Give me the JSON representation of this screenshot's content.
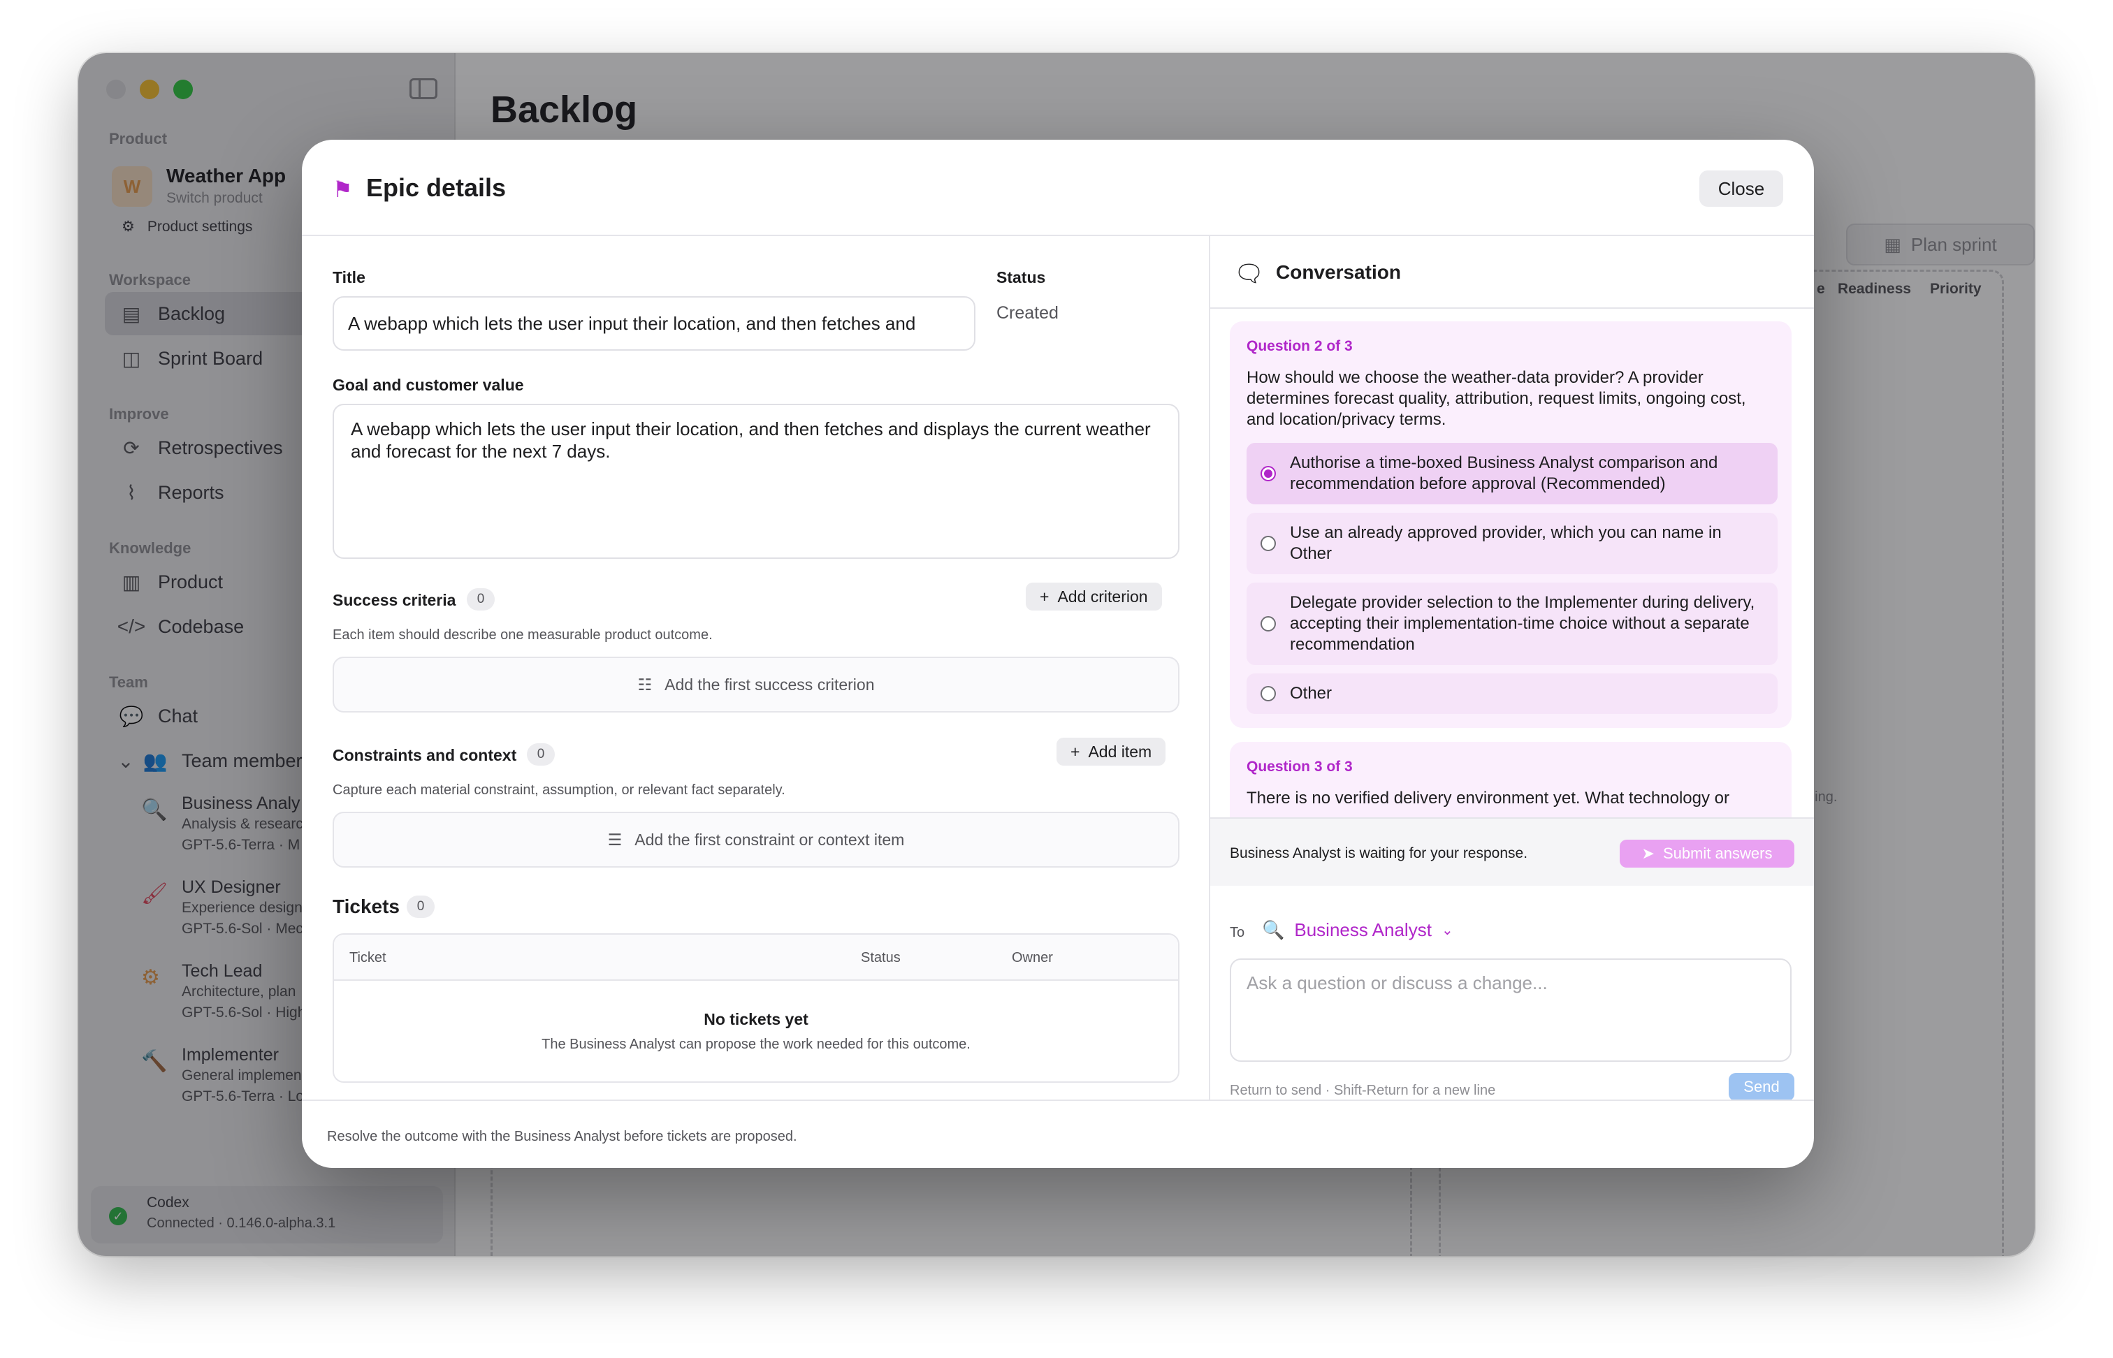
{
  "sidebar": {
    "product_section": "Product",
    "product_initial": "W",
    "product_name": "Weather App",
    "switch_product": "Switch product",
    "product_settings": "Product settings",
    "workspace_section": "Workspace",
    "backlog": "Backlog",
    "sprint_board": "Sprint Board",
    "improve_section": "Improve",
    "retrospectives": "Retrospectives",
    "reports": "Reports",
    "knowledge_section": "Knowledge",
    "product": "Product",
    "codebase": "Codebase",
    "team_section": "Team",
    "chat": "Chat",
    "team_members": "Team member",
    "agents": [
      {
        "name": "Business Analy",
        "line1": "Analysis & researc",
        "line2": "GPT-5.6-Terra · M",
        "icon": "magnifier-icon",
        "color": "#b027c9"
      },
      {
        "name": "UX Designer",
        "line1": "Experience design",
        "line2": "GPT-5.6-Sol · Mec",
        "icon": "brush-icon",
        "color": "#e0455a"
      },
      {
        "name": "Tech Lead",
        "line1": "Architecture, plan",
        "line2": "GPT-5.6-Sol · High",
        "icon": "nodes-icon",
        "color": "#e69a4a"
      },
      {
        "name": "Implementer",
        "line1": "General implemen",
        "line2": "GPT-5.6-Terra · Lo",
        "icon": "hammer-icon",
        "color": "#3a7bd5"
      }
    ],
    "codex_name": "Codex",
    "codex_status": "Connected · 0.146.0-alpha.3.1"
  },
  "main": {
    "title": "Backlog",
    "plan_sprint": "Plan sprint",
    "col_partial": "e",
    "col_readiness": "Readiness",
    "col_priority": "Priority",
    "empty_hint_partial": "ning."
  },
  "modal": {
    "title": "Epic details",
    "close": "Close",
    "title_label": "Title",
    "title_value": "A webapp which lets the user input their location, and then fetches and",
    "status_label": "Status",
    "status_value": "Created",
    "goal_label": "Goal and customer value",
    "goal_value": "A webapp which lets the user input their location, and then fetches and displays the current weather and forecast for the next 7 days.",
    "success_label": "Success criteria",
    "success_count": "0",
    "add_criterion": "Add criterion",
    "success_hint": "Each item should describe one measurable product outcome.",
    "success_empty": "Add the first success criterion",
    "constraints_label": "Constraints and context",
    "constraints_count": "0",
    "add_item": "Add item",
    "constraints_hint": "Capture each material constraint, assumption, or relevant fact separately.",
    "constraints_empty": "Add the first constraint or context item",
    "tickets_label": "Tickets",
    "tickets_count": "0",
    "tickets_columns": [
      "Ticket",
      "Status",
      "Owner"
    ],
    "tickets_empty_title": "No tickets yet",
    "tickets_empty_sub": "The Business Analyst can propose the work needed for this outcome.",
    "footer": "Resolve the outcome with the Business Analyst before tickets are proposed."
  },
  "conversation": {
    "title": "Conversation",
    "q2_label": "Question 2 of 3",
    "q2_text": "How should we choose the weather-data provider? A provider determines forecast quality, attribution, request limits, ongoing cost, and location/privacy terms.",
    "options": [
      {
        "label": "Authorise a time-boxed Business Analyst comparison and recommendation before approval (Recommended)",
        "selected": true
      },
      {
        "label": "Use an already approved provider, which you can name in Other",
        "selected": false
      },
      {
        "label": "Delegate provider selection to the Implementer during delivery, accepting their implementation-time choice without a separate recommendation",
        "selected": false
      },
      {
        "label": "Other",
        "selected": false
      }
    ],
    "q3_label": "Question 3 of 3",
    "q3_text": "There is no verified delivery environment yet. What technology or",
    "waiting": "Business Analyst is waiting for your response.",
    "submit": "Submit answers",
    "to_label": "To",
    "recipient": "Business Analyst",
    "placeholder": "Ask a question or discuss a change...",
    "send_hint": "Return to send · Shift-Return for a new line",
    "send": "Send"
  }
}
